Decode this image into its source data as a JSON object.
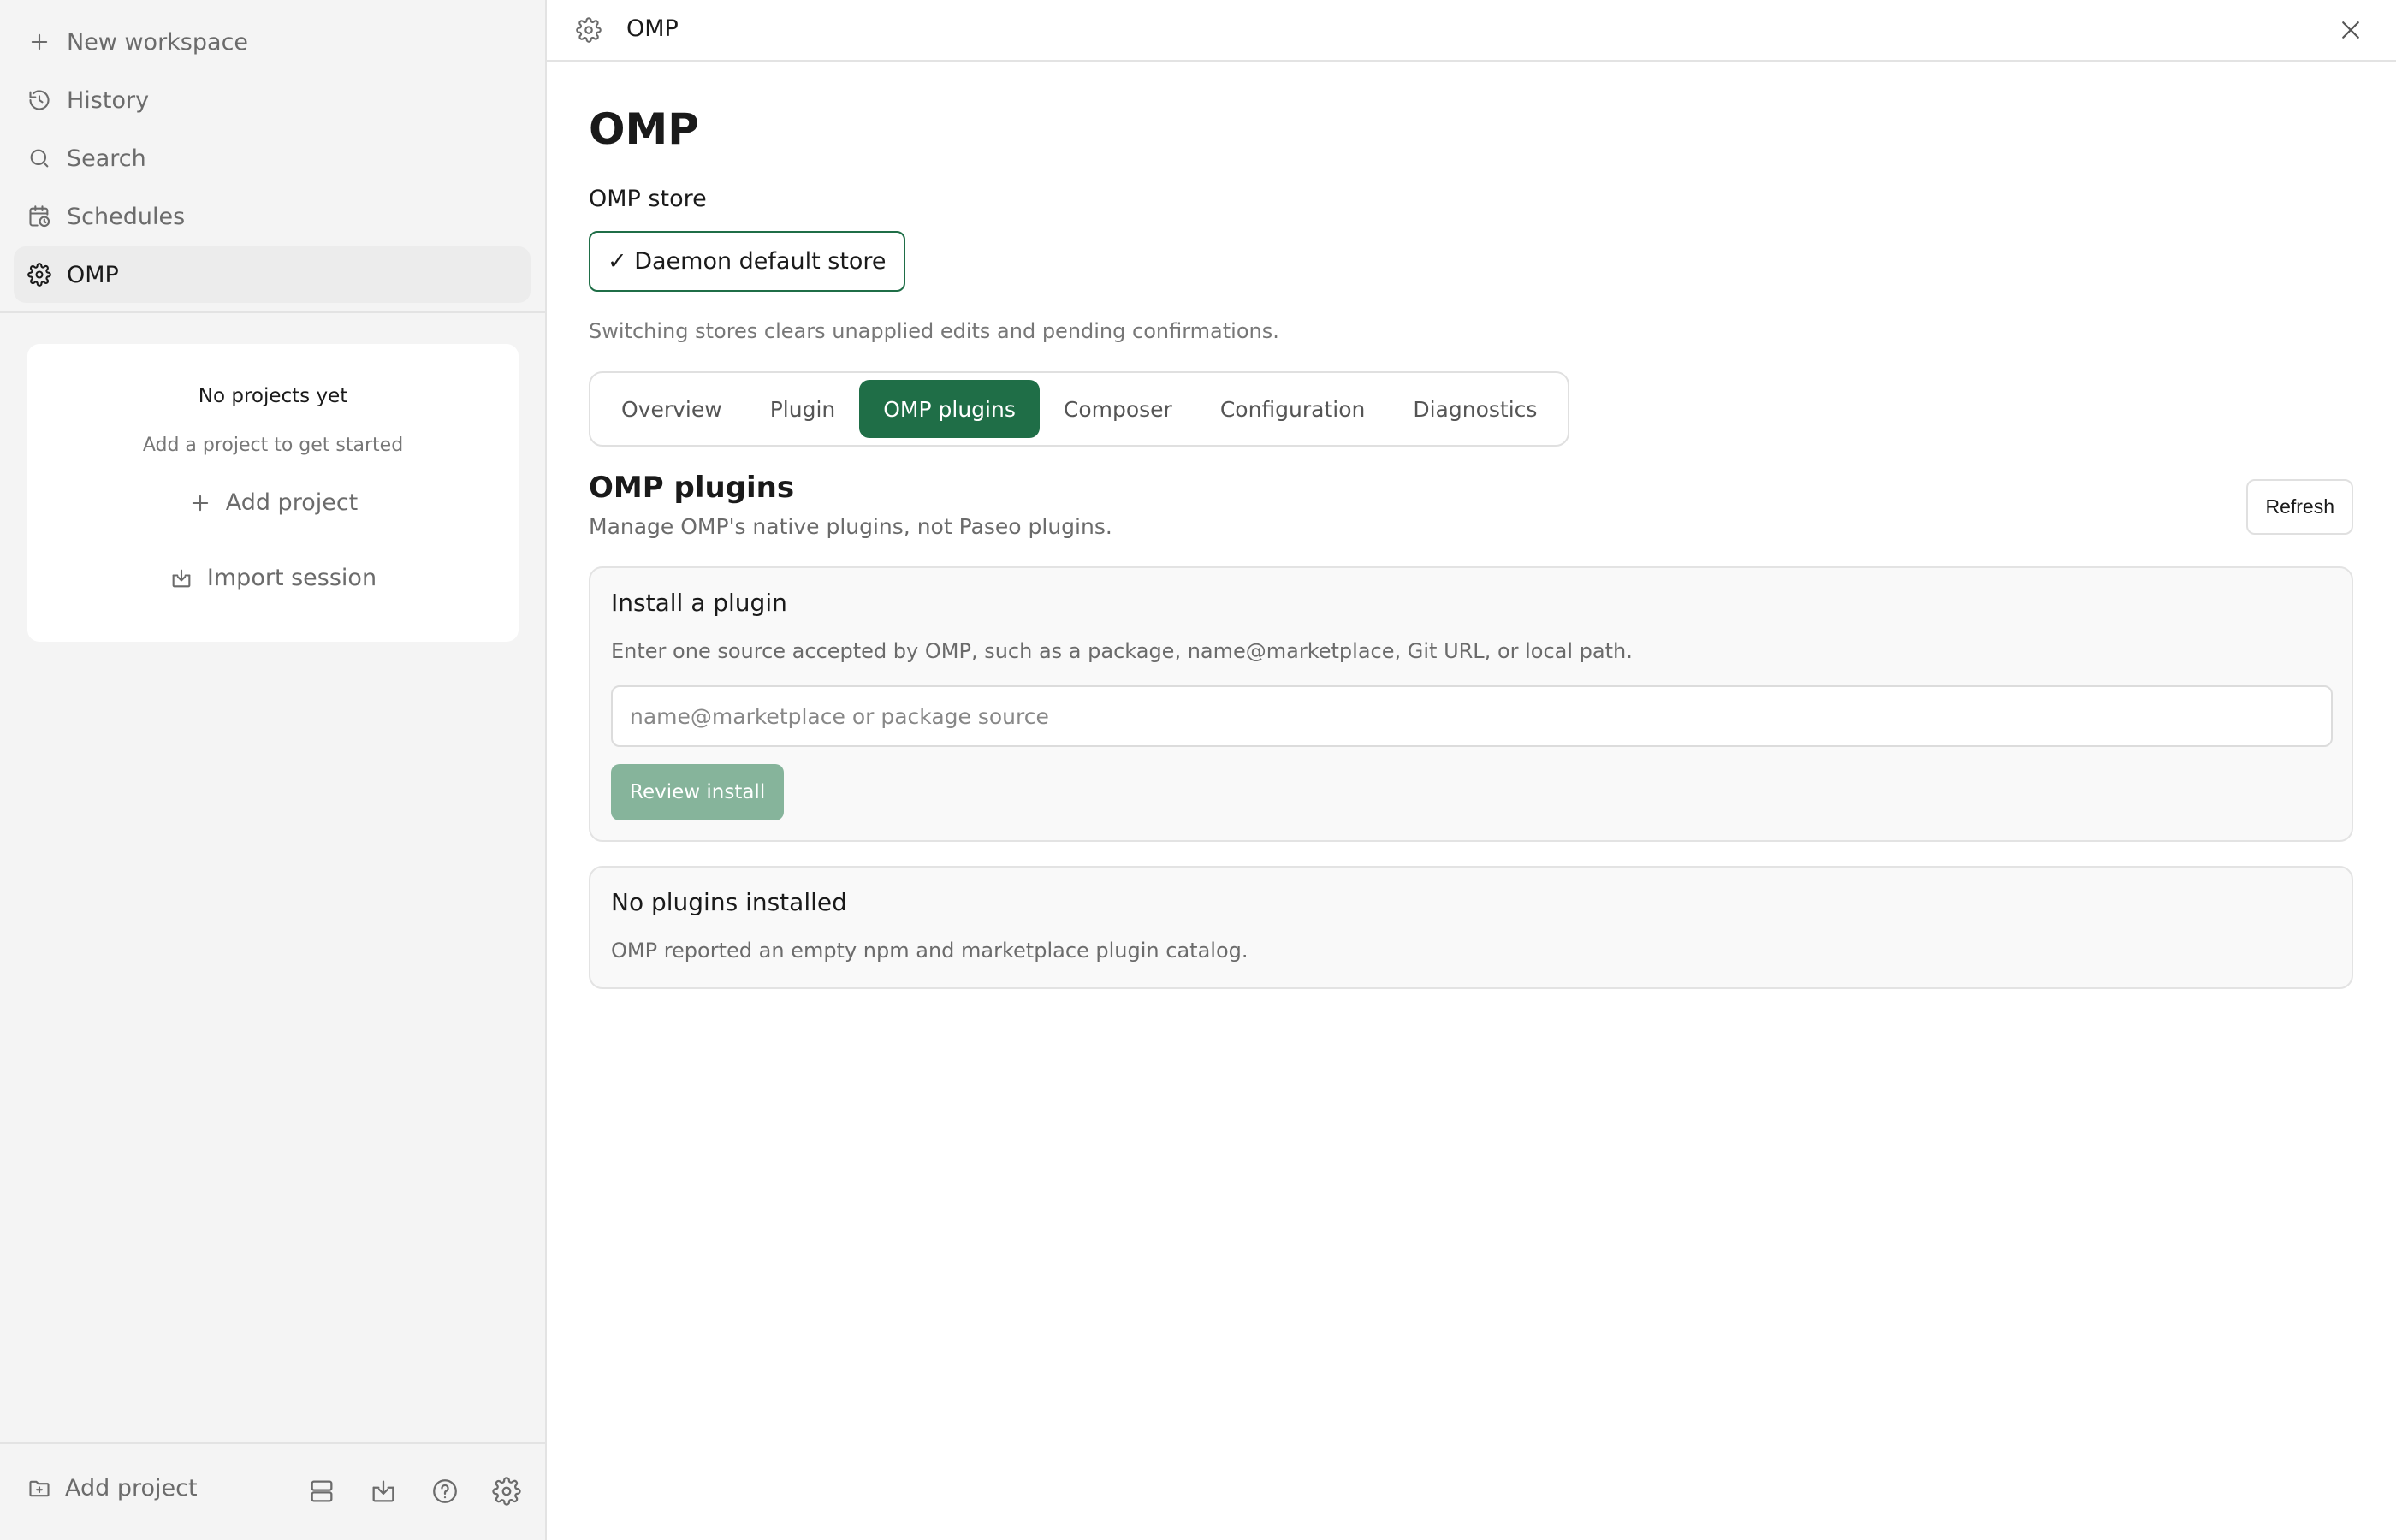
{
  "sidebar": {
    "nav": [
      {
        "label": "New workspace",
        "icon": "plus-icon"
      },
      {
        "label": "History",
        "icon": "history-icon"
      },
      {
        "label": "Search",
        "icon": "search-icon"
      },
      {
        "label": "Schedules",
        "icon": "calendar-clock-icon"
      },
      {
        "label": "OMP",
        "icon": "gear-icon",
        "active": true
      }
    ],
    "projects": {
      "empty_title": "No projects yet",
      "empty_subtitle": "Add a project to get started",
      "add_project_label": "Add project",
      "import_session_label": "Import session"
    },
    "footer": {
      "add_project_label": "Add project",
      "icons": [
        "server-icon",
        "download-icon",
        "help-icon",
        "gear-icon"
      ]
    }
  },
  "topbar": {
    "title": "OMP"
  },
  "main": {
    "page_title": "OMP",
    "store_label": "OMP store",
    "store_selected": "✓ Daemon default store",
    "store_hint": "Switching stores clears unapplied edits and pending confirmations.",
    "tabs": [
      {
        "label": "Overview"
      },
      {
        "label": "Plugin"
      },
      {
        "label": "OMP plugins",
        "active": true
      },
      {
        "label": "Composer"
      },
      {
        "label": "Configuration"
      },
      {
        "label": "Diagnostics"
      }
    ],
    "section_title": "OMP plugins",
    "section_subtitle": "Manage OMP's native plugins, not Paseo plugins.",
    "refresh_label": "Refresh",
    "install": {
      "title": "Install a plugin",
      "description": "Enter one source accepted by OMP, such as a package, name@marketplace, Git URL, or local path.",
      "input_value": "",
      "input_placeholder": "name@marketplace or package source",
      "review_label": "Review install"
    },
    "installed": {
      "title": "No plugins installed",
      "description": "OMP reported an empty npm and marketplace plugin catalog."
    }
  },
  "colors": {
    "accent": "#1f6e47",
    "accent_disabled": "#86b49b",
    "sidebar_bg": "#f4f4f4",
    "border": "#e3e3e3"
  }
}
